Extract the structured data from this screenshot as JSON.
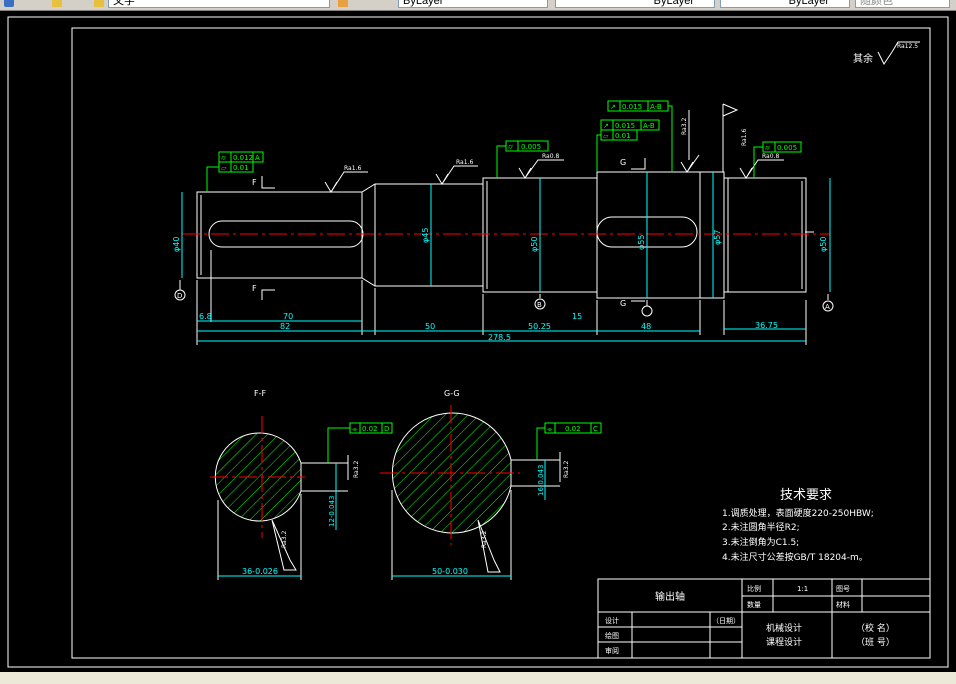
{
  "toolbar": {
    "text_style": "文字",
    "layer1": "ByLayer",
    "layer2": "ByLayer",
    "layer3": "ByLayer",
    "color_combo": "随颜色"
  },
  "roughness_note": {
    "label": "其余",
    "value": "Ra12.5"
  },
  "datums": [
    "A",
    "B",
    "D",
    "G",
    "F"
  ],
  "tolerance_frames": [
    {
      "symbol": "⌭",
      "value": "0.012",
      "datum": "A"
    },
    {
      "symbol": "▱",
      "value": "0.01",
      "datum": ""
    },
    {
      "symbol": "⌭",
      "value": "0.005",
      "datum": ""
    },
    {
      "symbol": "↗",
      "value": "0.015",
      "datum": "A-B"
    },
    {
      "symbol": "↗",
      "value": "0.015",
      "datum": "A-B"
    },
    {
      "symbol": "▱",
      "value": "0.01",
      "datum": ""
    },
    {
      "symbol": "⌭",
      "value": "0.005",
      "datum": ""
    },
    {
      "symbol": "⌯",
      "value": "0.02",
      "datum": "D"
    },
    {
      "symbol": "⌯",
      "value": "0.02",
      "datum": "C"
    }
  ],
  "roughness_marks": [
    "Ra1.6",
    "Ra1.6",
    "Ra0.8",
    "Ra3.2",
    "Ra3.2",
    "Ra1.6",
    "Ra0.8",
    "Ra3.2",
    "Ra3.2",
    "Ra3.2",
    "Ra3.2"
  ],
  "diameters": [
    "φ40",
    "φ45",
    "φ50",
    "φ55",
    "φ57",
    "φ50"
  ],
  "lengths": [
    "6.8",
    "70",
    "82",
    "50",
    "50.25",
    "15",
    "48",
    "36.75",
    "278.5"
  ],
  "sections": {
    "left": {
      "title": "F-F",
      "width_dim": "36-0.026",
      "depth_dim": "12-0.043"
    },
    "right": {
      "title": "G-G",
      "width_dim": "50-0.030",
      "depth_dim": "16-0.043"
    }
  },
  "section_letters": {
    "F": "F",
    "G": "G"
  },
  "tech_requirements": {
    "title": "技术要求",
    "items": [
      "1.调质处理，表面硬度220-250HBW;",
      "2.未注圆角半径R2;",
      "3.未注倒角为C1.5;",
      "4.未注尺寸公差按GB/T 18204-m。"
    ]
  },
  "title_block": {
    "part_name": "输出轴",
    "scale_label": "比例",
    "scale_value": "1:1",
    "drawing_no_label": "图号",
    "qty_label": "数量",
    "material_label": "材料",
    "design_label": "设计",
    "date_label": "（日期）",
    "draw_label": "绘图",
    "check_label": "审阅",
    "course1": "机械设计",
    "course2": "课程设计",
    "school": "（校  名）",
    "class": "（班  号）"
  }
}
